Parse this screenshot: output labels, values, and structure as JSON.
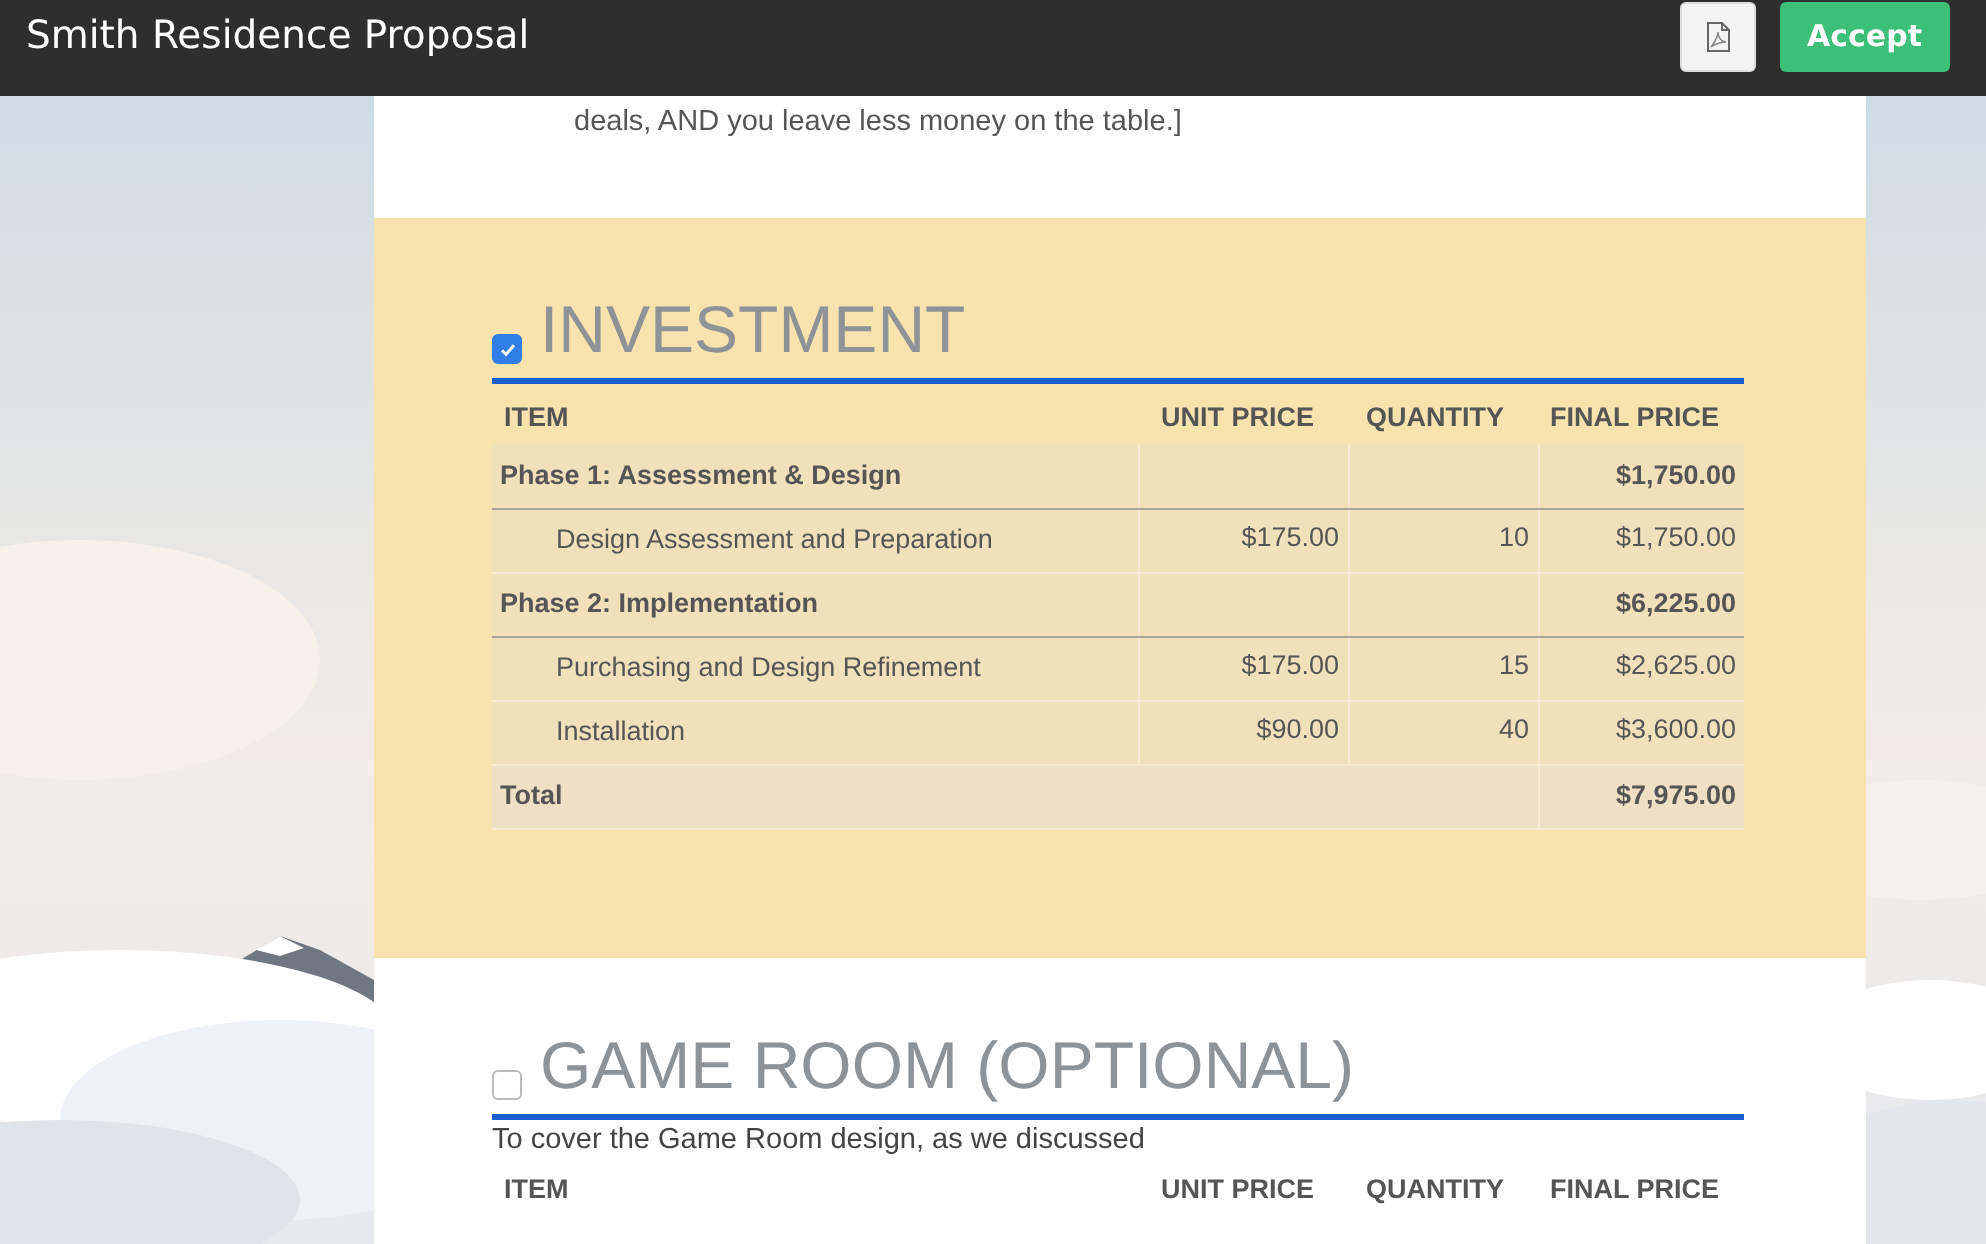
{
  "header": {
    "title": "Smith Residence Proposal",
    "buttons": [
      {
        "kind": "pdf"
      },
      {
        "kind": "text",
        "label": "Accept"
      }
    ]
  },
  "intro": {
    "text": "deals, AND you leave less money on the table.]"
  },
  "sections": [
    {
      "title": "INVESTMENT",
      "checked": true,
      "table": {
        "columns": [
          "ITEM",
          "UNIT PRICE",
          "QUANTITY",
          "FINAL PRICE"
        ],
        "rows": [
          {
            "kind": "group",
            "item": "Phase 1: Assessment & Design",
            "final_price": "$1,750.00"
          },
          {
            "kind": "item",
            "item": "Design Assessment and Preparation",
            "unit_price": "$175.00",
            "quantity": "10",
            "final_price": "$1,750.00"
          },
          {
            "kind": "group",
            "item": "Phase 2: Implementation",
            "final_price": "$6,225.00"
          },
          {
            "kind": "item",
            "item": "Purchasing and Design Refinement",
            "unit_price": "$175.00",
            "quantity": "15",
            "final_price": "$2,625.00"
          },
          {
            "kind": "item",
            "item": "Installation",
            "unit_price": "$90.00",
            "quantity": "40",
            "final_price": "$3,600.00"
          },
          {
            "kind": "total",
            "item": "Total",
            "final_price": "$7,975.00"
          }
        ]
      }
    },
    {
      "title": "GAME ROOM (OPTIONAL)",
      "checked": false,
      "description": "To cover the Game Room design, as we discussed",
      "table": {
        "columns": [
          "ITEM",
          "UNIT PRICE",
          "QUANTITY",
          "FINAL PRICE"
        ]
      }
    }
  ]
}
